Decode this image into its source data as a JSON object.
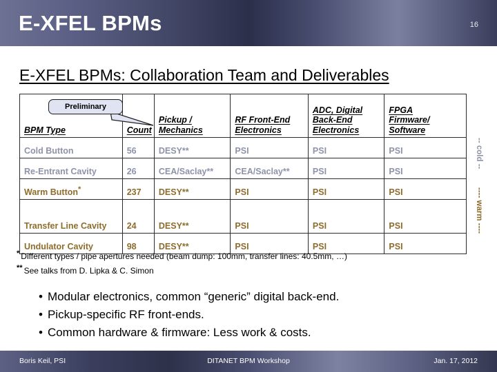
{
  "header": {
    "title": "E-XFEL BPMs",
    "page_number": "16"
  },
  "slide": {
    "title": "E-XFEL BPMs: Collaboration Team and Deliverables"
  },
  "callout": {
    "label": "Preliminary"
  },
  "table": {
    "columns": [
      "BPM Type",
      "Count",
      "Pickup / Mechanics",
      "RF Front-End Electronics",
      "ADC, Digital Back-End Electronics",
      "FPGA Firmware/ Software"
    ],
    "columns_lines": {
      "bpm_type": "BPM Type",
      "count": "Count",
      "pickup_l1": "Pickup /",
      "pickup_l2": "Mechanics",
      "rf_l1": "RF Front-End",
      "rf_l2": "Electronics",
      "adc_l1": "ADC, Digital",
      "adc_l2": "Back-End",
      "adc_l3": "Electronics",
      "fpga_l1": "FPGA",
      "fpga_l2": "Firmware/",
      "fpga_l3": "Software"
    },
    "rows": [
      {
        "group": "cold",
        "type": "Cold Button",
        "type_mark": "",
        "count": "56",
        "pickup": "DESY**",
        "rf": "PSI",
        "adc": "PSI",
        "fpga": "PSI"
      },
      {
        "group": "cold",
        "type": "Re-Entrant Cavity",
        "type_mark": "",
        "count": "26",
        "pickup": "CEA/Saclay**",
        "rf": "CEA/Saclay**",
        "adc": "PSI",
        "fpga": "PSI"
      },
      {
        "group": "warm",
        "type": "Warm Button",
        "type_mark": "*",
        "count": "237",
        "pickup": "DESY**",
        "rf": "PSI",
        "adc": "PSI",
        "fpga": "PSI"
      },
      {
        "group": "warm",
        "type": "Transfer Line Cavity",
        "type_mark": "",
        "count": "24",
        "pickup": "DESY**",
        "rf": "PSI",
        "adc": "PSI",
        "fpga": "PSI"
      },
      {
        "group": "warm",
        "type": "Undulator Cavity",
        "type_mark": "",
        "count": "98",
        "pickup": "DESY**",
        "rf": "PSI",
        "adc": "PSI",
        "fpga": "PSI"
      }
    ]
  },
  "side_labels": {
    "cold": "-- cold --",
    "warm": "---- warm ----"
  },
  "footnotes": [
    {
      "mark": "*",
      "text": "Different types / pipe apertures needed (beam dump: 100mm, transfer lines: 40.5mm, …)"
    },
    {
      "mark": "**",
      "text": "See talks from D. Lipka & C. Simon"
    }
  ],
  "bullets": [
    {
      "marker": "•",
      "text": "Modular electronics, common “generic” digital back-end."
    },
    {
      "marker": "•",
      "text": "Pickup-specific RF front-ends."
    },
    {
      "marker": "•",
      "text": "Common hardware & firmware: Less work & costs."
    }
  ],
  "footer": {
    "left": "Boris Keil, PSI",
    "center": "DITANET BPM Workshop",
    "right": "Jan. 17, 2012"
  },
  "colors": {
    "cold_text": "#8e93a8",
    "warm_text": "#8e6c2c",
    "banner_dark": "#2b2f4a",
    "banner_light": "#7b7fa0",
    "callout_fill": "#dfe3f2"
  }
}
